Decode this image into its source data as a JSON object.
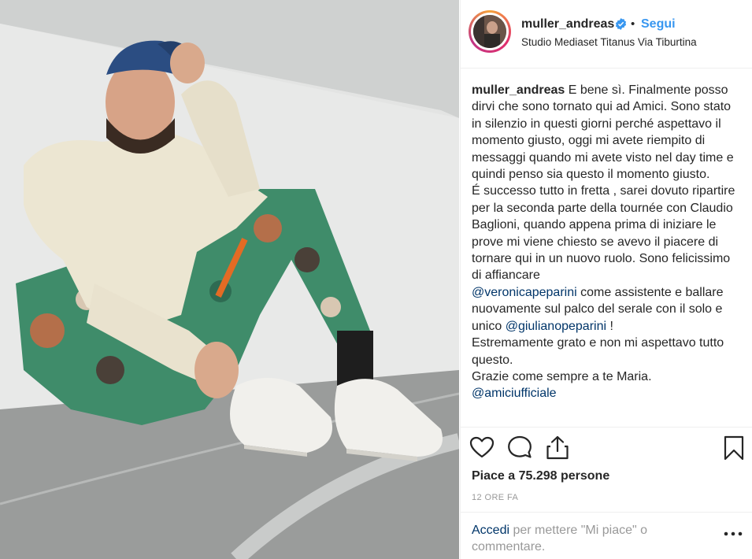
{
  "header": {
    "username": "muller_andreas",
    "separator": "•",
    "follow_label": "Segui",
    "location": "Studio Mediaset Titanus Via Tiburtina"
  },
  "caption": {
    "username": "muller_andreas",
    "text_1": " E bene sì. Finalmente posso dirvi che sono tornato qui ad Amici. Sono stato in silenzio in questi giorni perché aspettavo il momento giusto, oggi mi avete riempito di messaggi quando mi avete visto nel day time e quindi penso sia questo il momento giusto.\nÉ successo tutto in fretta , sarei dovuto ripartire per la seconda parte della tournée con Claudio Baglioni, quando appena prima di iniziare le prove mi viene chiesto se avevo il piacere di tornare qui in un nuovo ruolo. Sono felicissimo di affiancare\n",
    "mention_1": "@veronicapeparini",
    "text_2": " come assistente e ballare nuovamente sul palco del serale con il solo e unico ",
    "mention_2": "@giulianopeparini",
    "text_3": " !\nEstremamente grato e non mi aspettavo tutto questo.\nGrazie come sempre a te Maria.\n",
    "mention_3": "@amiciufficiale"
  },
  "actions": {
    "like_icon": "heart-icon",
    "comment_icon": "comment-icon",
    "share_icon": "share-icon",
    "save_icon": "bookmark-icon"
  },
  "likes_text": "Piace a 75.298 persone",
  "timestamp": "12 ORE FA",
  "login_prompt": {
    "link": "Accedi",
    "text": " per mettere \"Mi piace\" o commentare."
  },
  "more_icon": "more-options-icon",
  "colors": {
    "link_blue": "#3897f0",
    "mention_blue": "#003569",
    "muted": "#999999",
    "text": "#262626"
  }
}
